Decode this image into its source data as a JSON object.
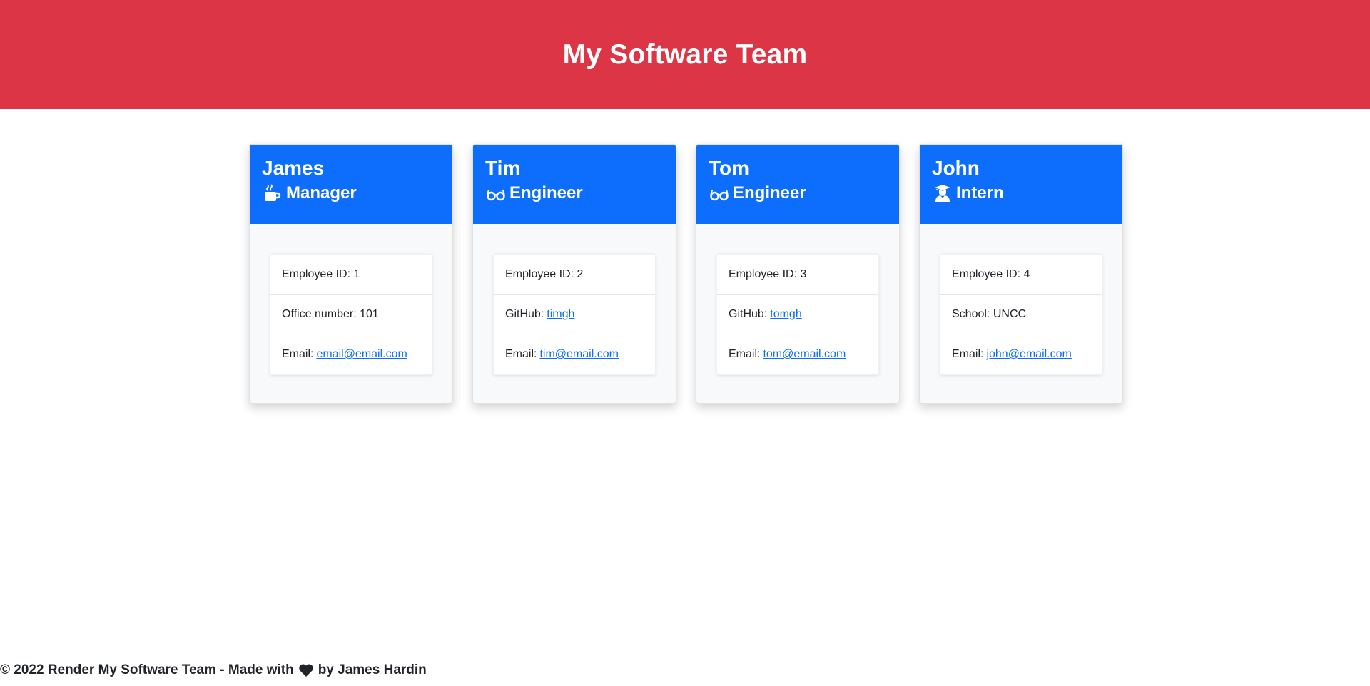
{
  "header": {
    "title": "My Software Team"
  },
  "team": [
    {
      "name": "James",
      "role": "Manager",
      "icon": "coffee-mug-icon",
      "details": [
        {
          "label": "Employee ID:",
          "value": "1",
          "link": false
        },
        {
          "label": "Office number:",
          "value": "101",
          "link": false
        },
        {
          "label": "Email:",
          "value": "email@email.com",
          "link": true
        }
      ]
    },
    {
      "name": "Tim",
      "role": "Engineer",
      "icon": "glasses-icon",
      "details": [
        {
          "label": "Employee ID:",
          "value": "2",
          "link": false
        },
        {
          "label": "GitHub:",
          "value": "timgh",
          "link": true
        },
        {
          "label": "Email:",
          "value": "tim@email.com",
          "link": true
        }
      ]
    },
    {
      "name": "Tom",
      "role": "Engineer",
      "icon": "glasses-icon",
      "details": [
        {
          "label": "Employee ID:",
          "value": "3",
          "link": false
        },
        {
          "label": "GitHub:",
          "value": "tomgh",
          "link": true
        },
        {
          "label": "Email:",
          "value": "tom@email.com",
          "link": true
        }
      ]
    },
    {
      "name": "John",
      "role": "Intern",
      "icon": "graduate-icon",
      "details": [
        {
          "label": "Employee ID:",
          "value": "4",
          "link": false
        },
        {
          "label": "School:",
          "value": "UNCC",
          "link": false
        },
        {
          "label": "Email:",
          "value": "john@email.com",
          "link": true
        }
      ]
    }
  ],
  "footer": {
    "text_before": "© 2022 Render My Software Team - Made with",
    "icon": "heart-icon",
    "text_after": "by James Hardin"
  },
  "colors": {
    "header_bg": "#dc3545",
    "card_header_bg": "#0d6efd",
    "link": "#0d6efd"
  }
}
